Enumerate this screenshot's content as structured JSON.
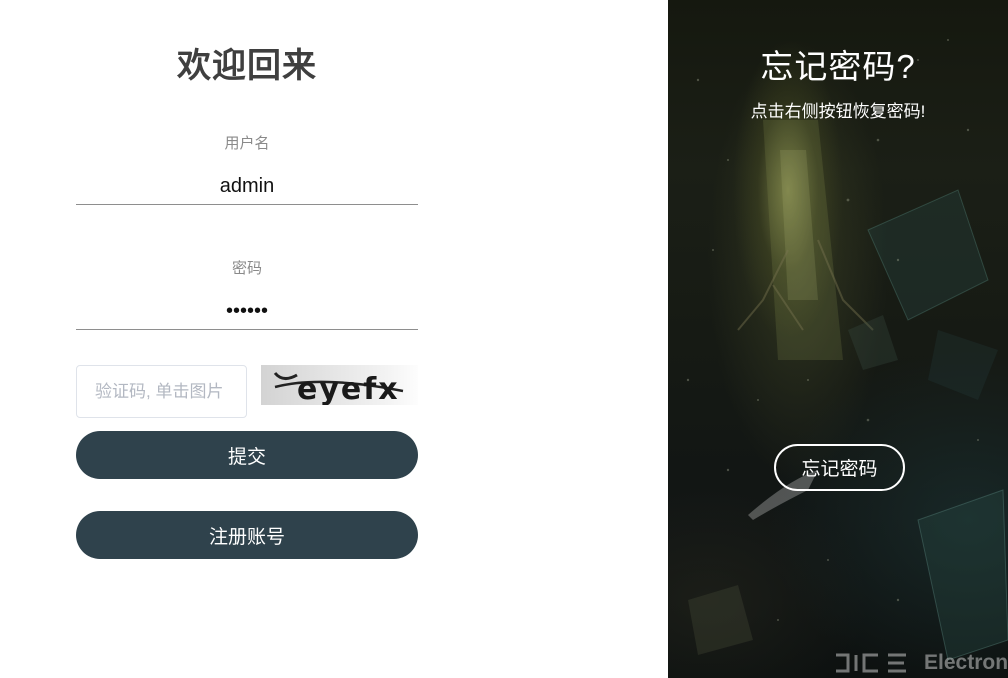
{
  "login": {
    "title": "欢迎回来",
    "username_label": "用户名",
    "username_value": "admin",
    "password_label": "密码",
    "password_value": "******",
    "captcha_placeholder": "验证码, 单击图片",
    "captcha_text": "eyefx",
    "submit_label": "提交",
    "register_label": "注册账号"
  },
  "side": {
    "title": "忘记密码?",
    "subtitle": "点击右侧按钮恢复密码!",
    "forgot_label": "忘记密码",
    "watermark_text": "Electron"
  },
  "colors": {
    "button_bg": "#2f424c",
    "title_text": "#3f3f3f"
  }
}
